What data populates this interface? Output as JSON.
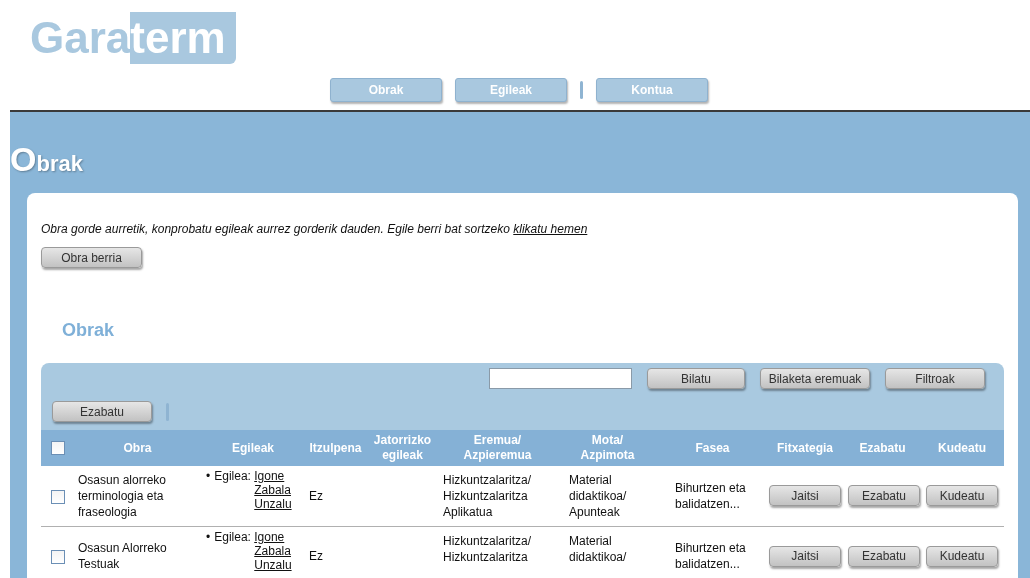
{
  "logo": {
    "part_1": "Gara",
    "part_2": "term"
  },
  "nav_groups": [
    [
      {
        "label": "Obrak"
      },
      {
        "label": "Egileak"
      }
    ],
    [
      {
        "label": "Kontua"
      }
    ]
  ],
  "page_title": "Obrak",
  "notice": {
    "text": "Obra gorde aurretik, konprobatu egileak aurrez gorderik dauden. Egile berri bat sortzeko",
    "link": "klikatu hemen"
  },
  "new_button": "Obra berria",
  "section_title": "Obrak",
  "toolbar": {
    "search_buttons": [
      "Bilatu",
      "Bilaketa eremuak",
      "Filtroak"
    ],
    "delete_button": "Ezabatu"
  },
  "table": {
    "select_all": {
      "checked": false
    },
    "columns": [
      "Obra",
      "Egileak",
      "Itzulpena",
      "Jatorrizko egileak",
      "Eremua/ Azpieremua",
      "Mota/ Azpimota",
      "Fasea",
      "Fitxategia",
      "Ezabatu",
      "Kudeatu"
    ],
    "rows": [
      {
        "checked": false,
        "obra": "Osasun alorreko terminologia eta fraseologia",
        "bullet": "•",
        "author_label": "Egilea:",
        "author": "Igone Zabala Unzalu",
        "itzulpena": "Ez",
        "eremua": "Hizkuntzalaritza/ Hizkuntzalaritza Aplikatua",
        "mota": "Material didaktikoa/ Apunteak",
        "fasea": "Bihurtzen eta balidatzen...",
        "buttons": [
          "Jaitsi",
          "Ezabatu",
          "Kudeatu"
        ]
      },
      {
        "checked": false,
        "obra": "Osasun Alorreko Testuak",
        "bullet": "•",
        "author_label": "Egilea:",
        "author": "Igone Zabala Unzalu",
        "itzulpena": "Ez",
        "eremua": "Hizkuntzalaritza/ Hizkuntzalaritza",
        "mota": "Material didaktikoa/",
        "fasea": "Bihurtzen eta balidatzen...",
        "buttons": [
          "Jaitsi",
          "Ezabatu",
          "Kudeatu"
        ]
      }
    ]
  }
}
